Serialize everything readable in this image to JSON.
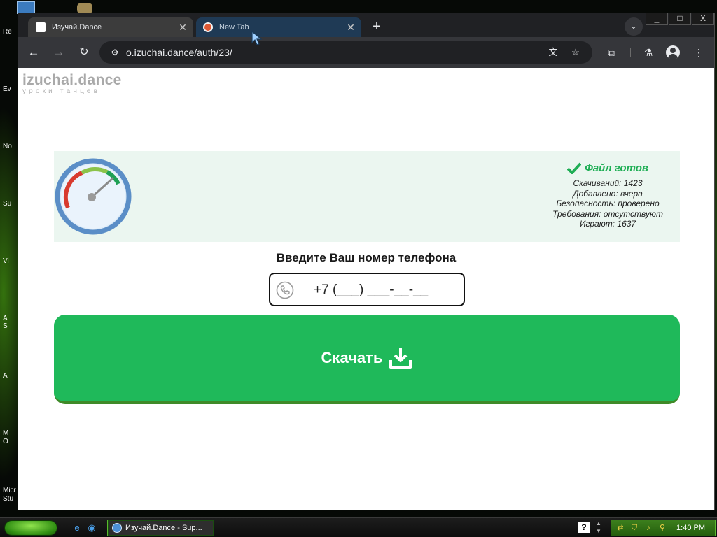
{
  "desktop": {
    "icon_labels": [
      {
        "label": "Re"
      },
      {
        "label": "Ev"
      },
      {
        "label": "No"
      },
      {
        "label": "Su"
      },
      {
        "label": "Vi"
      },
      {
        "label": "A"
      },
      {
        "label": "S"
      },
      {
        "label": "A"
      },
      {
        "label": "M"
      },
      {
        "label": "O"
      },
      {
        "label": "Micr"
      },
      {
        "label": "Stu"
      }
    ]
  },
  "browser": {
    "tabs": [
      {
        "title": "Изучай.Dance",
        "favicon": "white-page-icon",
        "active": true
      },
      {
        "title": "New Tab",
        "favicon": "duckduckgo-icon",
        "active": false
      }
    ],
    "new_tab_glyph": "+",
    "tab_search_glyph": "⌄",
    "window_controls": [
      "_",
      "□",
      "X"
    ],
    "url": "o.izuchai.dance/auth/23/",
    "icons": [
      "back-icon",
      "forward-icon",
      "reload-icon",
      "site-info-icon",
      "translate-icon",
      "bookmark-star-icon",
      "extensions-icon",
      "labs-flask-icon",
      "profile-avatar-icon",
      "more-menu-icon"
    ]
  },
  "page": {
    "logo_main": "izuchai.dance",
    "logo_sub": "уроки танцев",
    "file_status": {
      "ready": "Файл готов",
      "lines": [
        "Скачиваний: 1423",
        "Добавлено: вчера",
        "Безопасность: проверено",
        "Требования: отсутствуют",
        "Играют: 1637"
      ]
    },
    "phone_prompt": "Введите Ваш номер телефона",
    "phone_value": "+7 (___) ___-__-__",
    "download_label": "Скачать",
    "colors": {
      "accent_green": "#1fb95a",
      "panel_bg": "#ebf6f0",
      "ready_green": "#1fae55",
      "gauge_ring": "#5b8ec7"
    }
  },
  "taskbar": {
    "task_title": "Изучай.Dance - Sup...",
    "clock": "1:40 PM",
    "help_glyph": "?",
    "tray_icons": [
      "network-icon",
      "security-shield-icon",
      "volume-icon",
      "search-icon"
    ]
  }
}
